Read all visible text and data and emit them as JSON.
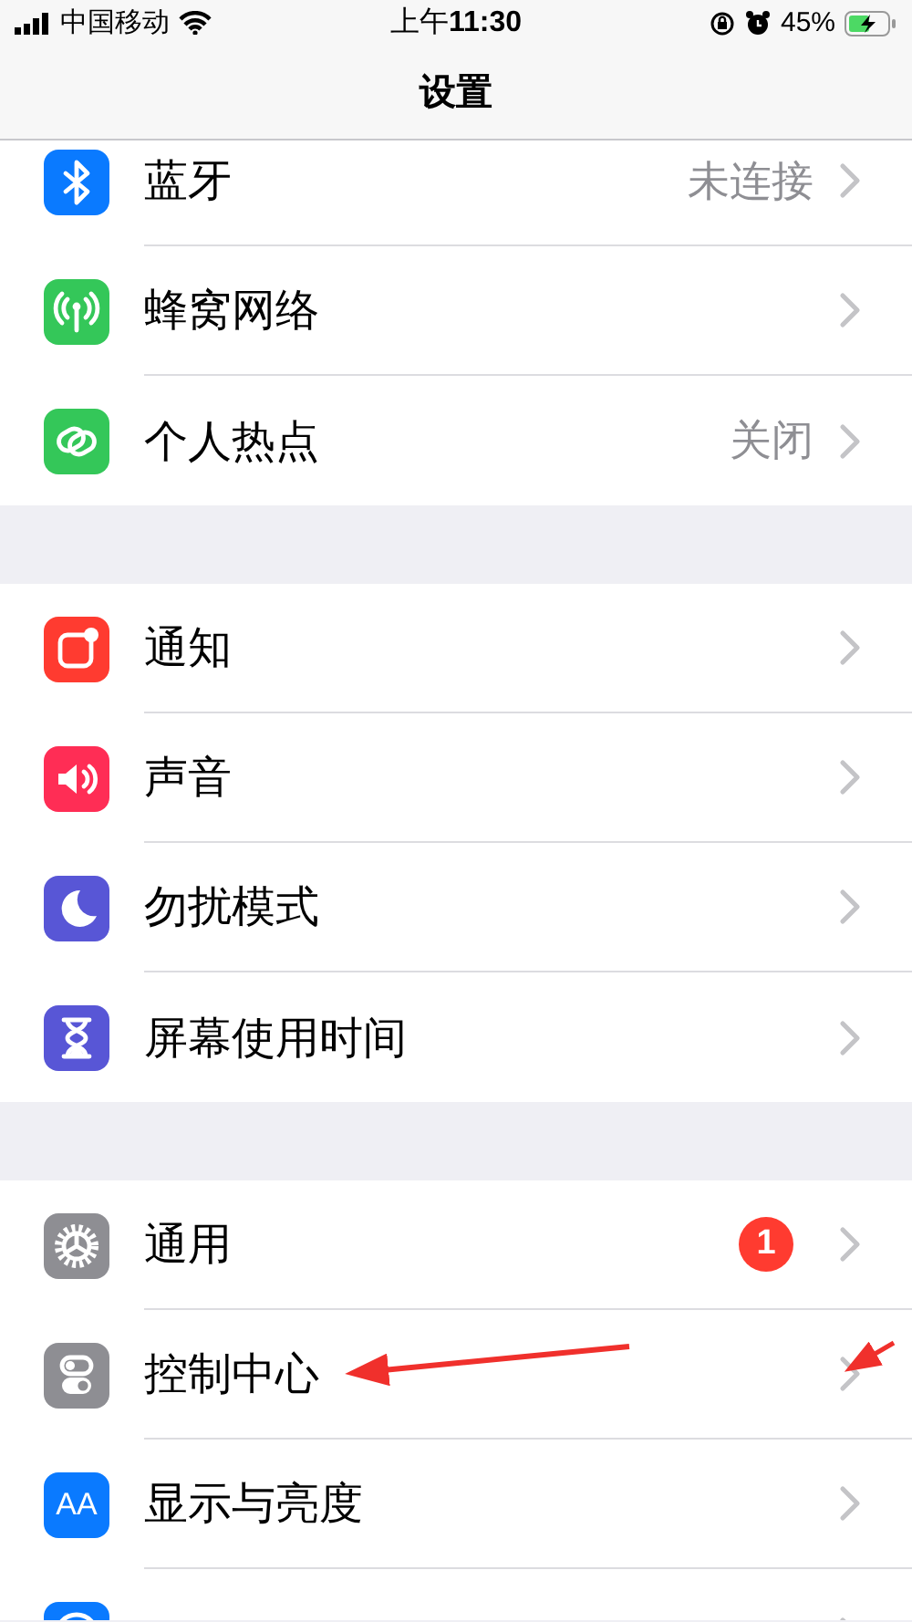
{
  "status_bar": {
    "carrier": "中国移动",
    "time": "上午**11:30**",
    "battery": "45%"
  },
  "nav": {
    "title": "设置"
  },
  "groups": [
    {
      "rows": [
        {
          "label": "蓝牙",
          "value": "未连接",
          "color": "#0a7aff"
        },
        {
          "label": "蜂窝网络",
          "color": "#34c759"
        },
        {
          "label": "个人热点",
          "value": "关闭",
          "color": "#34c759"
        }
      ]
    },
    {
      "rows": [
        {
          "label": "通知",
          "color": "#ff3b30"
        },
        {
          "label": "声音",
          "color": "#ff2d55"
        },
        {
          "label": "勿扰模式",
          "color": "#5856d6"
        },
        {
          "label": "屏幕使用时间",
          "color": "#5856d6"
        }
      ]
    },
    {
      "rows": [
        {
          "label": "通用",
          "badge": "1",
          "color": "#8e8e93"
        },
        {
          "label": "控制中心",
          "color": "#8e8e93"
        },
        {
          "label": "显示与亮度",
          "icon_text": "AA",
          "color": "#0a7aff"
        },
        {
          "color": "#0a7aff"
        }
      ]
    }
  ]
}
